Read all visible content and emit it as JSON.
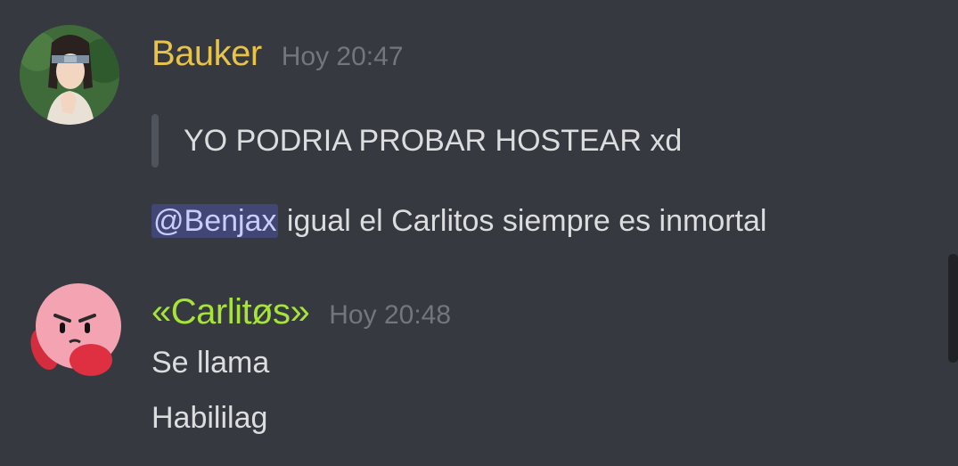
{
  "messages": [
    {
      "username": "Bauker",
      "username_color": "#e8c34a",
      "timestamp": "Hoy 20:47",
      "avatar_icon": "neji-avatar",
      "quote": "YO PODRIA PROBAR HOSTEAR xd",
      "mention": "@Benjax",
      "text": " igual el Carlitos siempre es inmortal"
    },
    {
      "username": "«Carlitøs»",
      "username_color": "#a6e43a",
      "timestamp": "Hoy 20:48",
      "avatar_icon": "kirby-avatar",
      "lines": [
        "Se llama",
        "Habililag"
      ]
    }
  ],
  "colors": {
    "background": "#36393f",
    "text": "#dcddde",
    "timestamp": "#72767d",
    "mention_bg": "#414675",
    "mention_text": "#c9cdfb"
  }
}
